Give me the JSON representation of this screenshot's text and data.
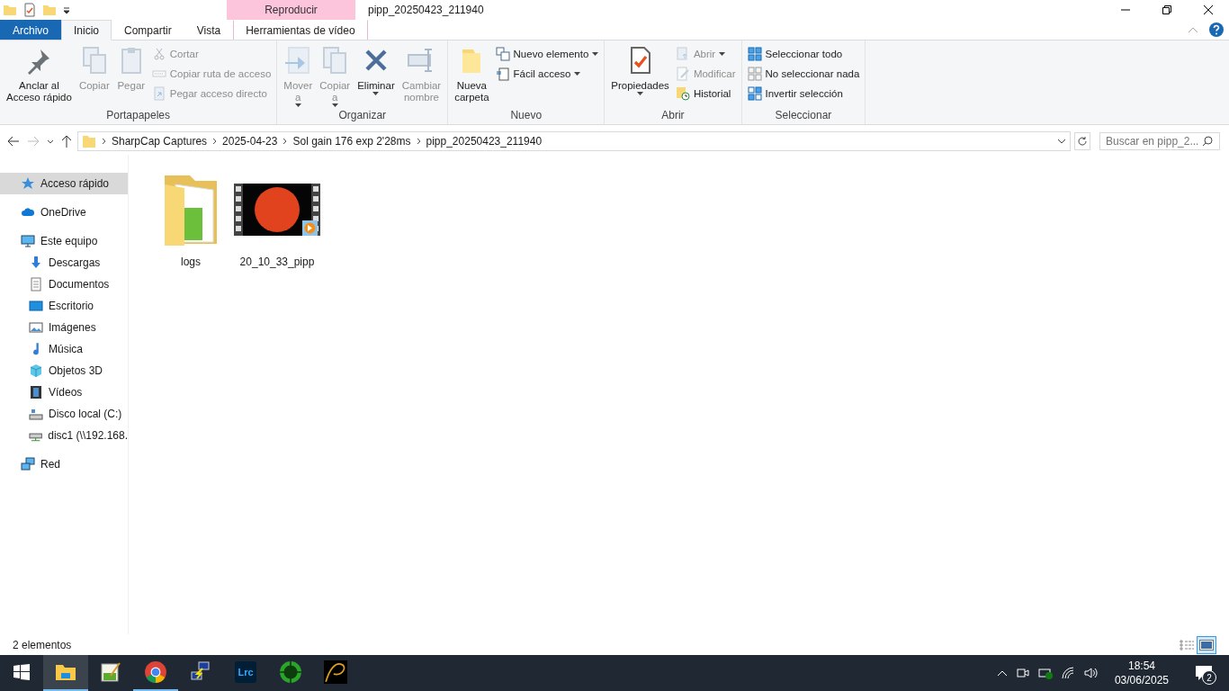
{
  "window": {
    "title": "pipp_20250423_211940",
    "context_tab": "Reproducir"
  },
  "ribbon_tabs": [
    {
      "label": "Archivo",
      "kind": "file",
      "selected": false
    },
    {
      "label": "Inicio",
      "kind": "tab",
      "selected": true
    },
    {
      "label": "Compartir",
      "kind": "tab",
      "selected": false
    },
    {
      "label": "Vista",
      "kind": "tab",
      "selected": false
    },
    {
      "label": "Herramientas de vídeo",
      "kind": "tab",
      "selected": false
    }
  ],
  "ribbon_groups": [
    {
      "label": "Portapapeles",
      "items": [
        {
          "kind": "large",
          "lines": [
            "Anclar al",
            "Acceso rápido"
          ],
          "disabled": false
        },
        {
          "kind": "large",
          "lines": [
            "Copiar"
          ],
          "disabled": true
        },
        {
          "kind": "large",
          "lines": [
            "Pegar"
          ],
          "disabled": true
        },
        {
          "kind": "stack",
          "children": [
            {
              "label": "Cortar",
              "disabled": true
            },
            {
              "label": "Copiar ruta de acceso",
              "disabled": true
            },
            {
              "label": "Pegar acceso directo",
              "disabled": true
            }
          ]
        }
      ]
    },
    {
      "label": "Organizar",
      "items": [
        {
          "kind": "large",
          "lines": [
            "Mover",
            "a"
          ],
          "dropdown": true,
          "disabled": true
        },
        {
          "kind": "large",
          "lines": [
            "Copiar",
            "a"
          ],
          "dropdown": true,
          "disabled": true
        },
        {
          "kind": "large",
          "lines": [
            "Eliminar"
          ],
          "dropdown": true,
          "disabled": false
        },
        {
          "kind": "large",
          "lines": [
            "Cambiar",
            "nombre"
          ],
          "disabled": true
        }
      ]
    },
    {
      "label": "Nuevo",
      "items": [
        {
          "kind": "large",
          "lines": [
            "Nueva",
            "carpeta"
          ],
          "disabled": false
        },
        {
          "kind": "stack",
          "children": [
            {
              "label": "Nuevo elemento",
              "dropdown": true,
              "disabled": false
            },
            {
              "label": "Fácil acceso",
              "dropdown": true,
              "disabled": false
            }
          ]
        }
      ]
    },
    {
      "label": "Abrir",
      "items": [
        {
          "kind": "large",
          "lines": [
            "Propiedades"
          ],
          "dropdown": true,
          "disabled": false
        },
        {
          "kind": "stack",
          "children": [
            {
              "label": "Abrir",
              "dropdown": true,
              "disabled": true
            },
            {
              "label": "Modificar",
              "disabled": true
            },
            {
              "label": "Historial",
              "disabled": false
            }
          ]
        }
      ]
    },
    {
      "label": "Seleccionar",
      "items": [
        {
          "kind": "stack",
          "children": [
            {
              "label": "Seleccionar todo",
              "disabled": false
            },
            {
              "label": "No seleccionar nada",
              "disabled": false
            },
            {
              "label": "Invertir selección",
              "disabled": false
            }
          ]
        }
      ]
    }
  ],
  "address_bar": {
    "path": [
      "SharpCap Captures",
      "2025-04-23",
      "Sol gain 176 exp 2'28ms",
      "pipp_20250423_211940"
    ],
    "search_placeholder": "Buscar en pipp_2..."
  },
  "sidebar": {
    "items": [
      {
        "label": "Acceso rápido",
        "selected": true
      },
      {
        "label": "OneDrive",
        "selected": false
      },
      {
        "label": "Este equipo",
        "selected": false,
        "children": [
          {
            "label": "Descargas",
            "selected": false
          },
          {
            "label": "Documentos",
            "selected": false
          },
          {
            "label": "Escritorio",
            "selected": false
          },
          {
            "label": "Imágenes",
            "selected": false
          },
          {
            "label": "Música",
            "selected": false
          },
          {
            "label": "Objetos 3D",
            "selected": false
          },
          {
            "label": "Vídeos",
            "selected": false
          },
          {
            "label": "Disco local (C:)",
            "selected": false
          },
          {
            "label": "disc1 (\\\\192.168.",
            "selected": false
          }
        ]
      },
      {
        "label": "Red",
        "selected": false
      }
    ]
  },
  "files": [
    {
      "name": "logs",
      "kind": "folder"
    },
    {
      "name": "20_10_33_pipp",
      "kind": "video"
    }
  ],
  "status_bar": {
    "count": "2 elementos",
    "views": [
      {
        "kind": "details",
        "selected": false
      },
      {
        "kind": "large",
        "selected": true
      }
    ]
  },
  "taskbar": {
    "apps": [
      {
        "kind": "explorer",
        "active": true
      },
      {
        "kind": "notepad",
        "active": false
      },
      {
        "kind": "chrome",
        "active": true
      },
      {
        "kind": "network",
        "active": false
      },
      {
        "kind": "lrc",
        "label": "Lrc",
        "active": false
      },
      {
        "kind": "target",
        "active": false
      },
      {
        "kind": "curve",
        "active": false
      }
    ],
    "time": "18:54",
    "date": "03/06/2025",
    "notifications": "2"
  }
}
